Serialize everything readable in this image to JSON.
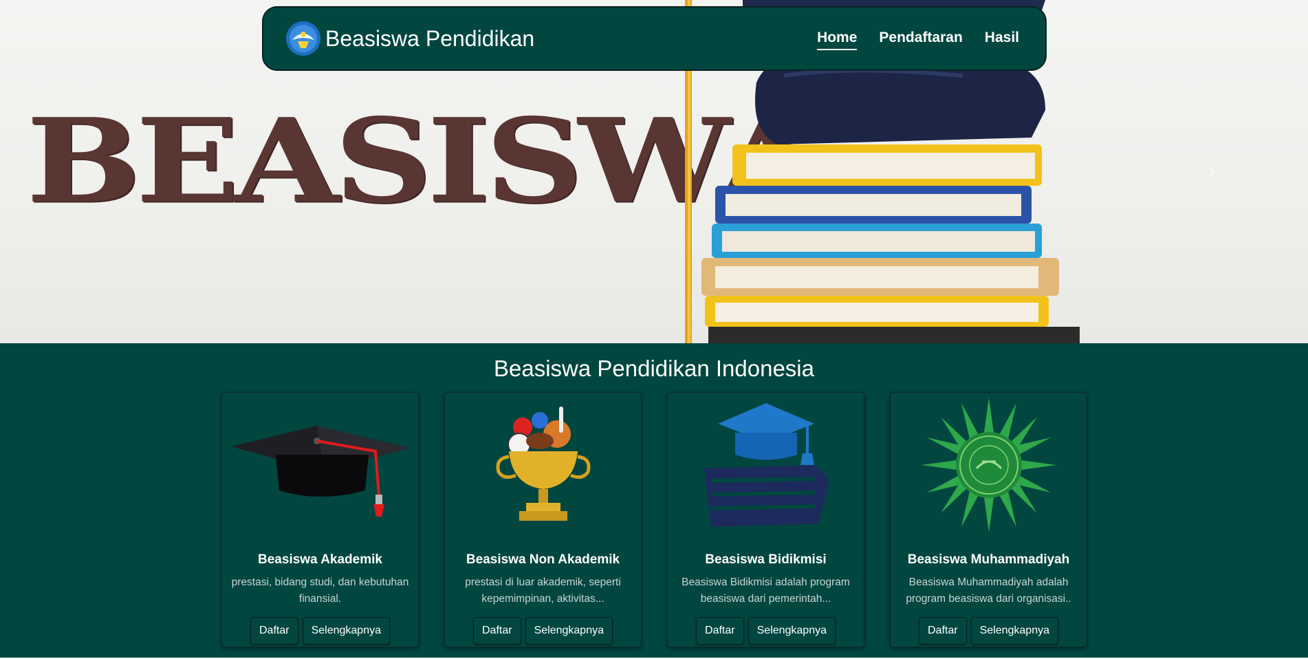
{
  "brand": {
    "name": "Beasiswa Pendidikan",
    "logo_icon": "tut-wuri-handayani-logo-icon"
  },
  "nav": [
    {
      "label": "Home",
      "active": true
    },
    {
      "label": "Pendaftaran",
      "active": false
    },
    {
      "label": "Hasil",
      "active": false
    }
  ],
  "hero": {
    "banner_word": "BEASISWA",
    "next_icon": "chevron-right-icon"
  },
  "section": {
    "title": "Beasiswa Pendidikan Indonesia"
  },
  "cards": [
    {
      "title": "Beasiswa Akademik",
      "text": "prestasi, bidang studi, dan kebutuhan finansial.",
      "icon": "graduation-cap-icon",
      "register_label": "Daftar",
      "more_label": "Selengkapnya"
    },
    {
      "title": "Beasiswa Non Akademik",
      "text": "prestasi di luar akademik, seperti kepemimpinan, aktivitas...",
      "icon": "sports-trophy-icon",
      "register_label": "Daftar",
      "more_label": "Selengkapnya"
    },
    {
      "title": "Beasiswa Bidikmisi",
      "text": "Beasiswa Bidikmisi adalah program beasiswa dari pemerintah...",
      "icon": "cap-on-books-icon",
      "register_label": "Daftar",
      "more_label": "Selengkapnya"
    },
    {
      "title": "Beasiswa Muhammadiyah",
      "text": "Beasiswa Muhammadiyah adalah program beasiswa dari organisasi..",
      "icon": "muhammadiyah-emblem-icon",
      "register_label": "Daftar",
      "more_label": "Selengkapnya"
    }
  ],
  "colors": {
    "primary": "#024640",
    "banner_text": "#5a3633",
    "card_text": "#c9d6d3"
  }
}
